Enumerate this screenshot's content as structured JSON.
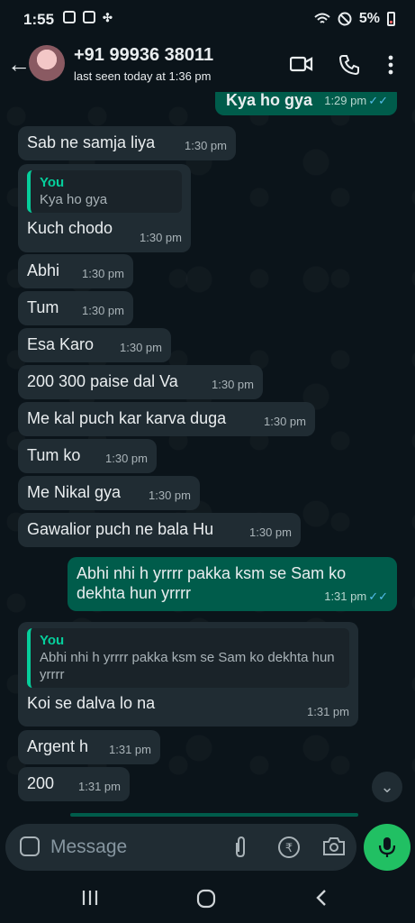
{
  "status_bar": {
    "time": "1:55",
    "battery": "5%"
  },
  "header": {
    "contact": "+91 99936 38011",
    "last_seen": "last seen today at 1:36 pm"
  },
  "messages": [
    {
      "dir": "out",
      "text": "Kya ho gya",
      "time": "1:29 pm",
      "read": true
    },
    {
      "dir": "in",
      "text": "Sab ne samja liya",
      "time": "1:30 pm"
    },
    {
      "dir": "in",
      "quote_name": "You",
      "quote_text": "Kya ho gya",
      "text": "Kuch chodo",
      "time": "1:30 pm"
    },
    {
      "dir": "in",
      "text": "Abhi",
      "time": "1:30 pm"
    },
    {
      "dir": "in",
      "text": "Tum",
      "time": "1:30 pm"
    },
    {
      "dir": "in",
      "text": "Esa Karo",
      "time": "1:30 pm"
    },
    {
      "dir": "in",
      "text": "200 300 paise dal Va",
      "time": "1:30 pm"
    },
    {
      "dir": "in",
      "text": "Me kal puch kar karva duga",
      "time": "1:30 pm"
    },
    {
      "dir": "in",
      "text": "Tum ko",
      "time": "1:30 pm"
    },
    {
      "dir": "in",
      "text": "Me Nikal gya",
      "time": "1:30 pm"
    },
    {
      "dir": "in",
      "text": "Gawalior puch ne bala Hu",
      "time": "1:30 pm"
    },
    {
      "dir": "out",
      "text": "Abhi nhi h yrrrr pakka ksm se Sam ko dekhta hun yrrrr",
      "time": "1:31 pm",
      "read": true
    },
    {
      "dir": "in",
      "quote_name": "You",
      "quote_text": "Abhi nhi h yrrrr pakka ksm se Sam ko dekhta hun yrrrr",
      "text": "Koi se dalva lo na",
      "time": "1:31 pm"
    },
    {
      "dir": "in",
      "text": "Argent h",
      "time": "1:31 pm"
    },
    {
      "dir": "in",
      "text": "200",
      "time": "1:31 pm"
    }
  ],
  "input": {
    "placeholder": "Message"
  },
  "icons": [
    "back-arrow-icon",
    "video-call-icon",
    "phone-icon",
    "more-icon",
    "emoji-icon",
    "attach-icon",
    "rupee-icon",
    "camera-icon",
    "mic-icon",
    "scroll-down-icon"
  ],
  "colors": {
    "background": "#0b141a",
    "incoming": "#202c33",
    "outgoing": "#005c4b",
    "accent": "#21c063",
    "read_ticks": "#53bdeb"
  }
}
